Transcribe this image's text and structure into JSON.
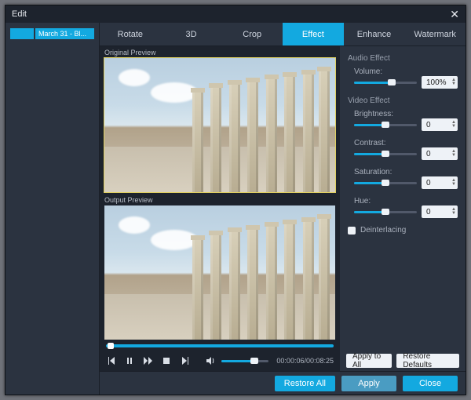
{
  "window": {
    "title": "Edit"
  },
  "sidebar": {
    "clip_label": "March 31 - Bl..."
  },
  "tabs": [
    {
      "label": "Rotate",
      "active": false
    },
    {
      "label": "3D",
      "active": false
    },
    {
      "label": "Crop",
      "active": false
    },
    {
      "label": "Effect",
      "active": true
    },
    {
      "label": "Enhance",
      "active": false
    },
    {
      "label": "Watermark",
      "active": false
    }
  ],
  "previews": {
    "original_label": "Original Preview",
    "output_label": "Output Preview"
  },
  "transport": {
    "time_current": "00:00:06",
    "time_total": "00:08:25",
    "seek_pct": 2,
    "volume_pct": 70
  },
  "panel": {
    "audio_section": "Audio Effect",
    "video_section": "Video Effect",
    "volume": {
      "label": "Volume:",
      "value": "100%",
      "pct": 60
    },
    "brightness": {
      "label": "Brightness:",
      "value": "0",
      "pct": 50
    },
    "contrast": {
      "label": "Contrast:",
      "value": "0",
      "pct": 50
    },
    "saturation": {
      "label": "Saturation:",
      "value": "0",
      "pct": 50
    },
    "hue": {
      "label": "Hue:",
      "value": "0",
      "pct": 50
    },
    "deinterlace_label": "Deinterlacing",
    "apply_all": "Apply to All",
    "restore_defaults": "Restore Defaults"
  },
  "footer": {
    "restore_all": "Restore All",
    "apply": "Apply",
    "close": "Close"
  }
}
